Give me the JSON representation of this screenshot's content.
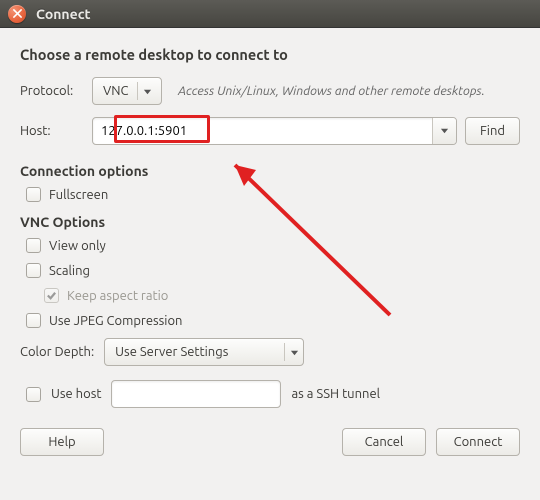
{
  "window": {
    "title": "Connect"
  },
  "heading": "Choose a remote desktop to connect to",
  "protocol": {
    "label": "Protocol:",
    "value": "VNC",
    "hint": "Access Unix/Linux, Windows and other remote desktops."
  },
  "host": {
    "label": "Host:",
    "value": "127.0.0.1:5901",
    "find_label": "Find"
  },
  "connection_options": {
    "heading": "Connection options",
    "fullscreen": {
      "label": "Fullscreen",
      "checked": false
    }
  },
  "vnc_options": {
    "heading": "VNC Options",
    "view_only": {
      "label": "View only",
      "checked": false
    },
    "scaling": {
      "label": "Scaling",
      "checked": false
    },
    "keep_aspect": {
      "label": "Keep aspect ratio",
      "checked": true,
      "disabled": true
    },
    "jpeg": {
      "label": "Use JPEG Compression",
      "checked": false
    },
    "color_depth": {
      "label": "Color Depth:",
      "value": "Use Server Settings"
    },
    "ssh": {
      "label": "Use host",
      "suffix": "as a SSH tunnel",
      "checked": false,
      "value": ""
    }
  },
  "buttons": {
    "help": "Help",
    "cancel": "Cancel",
    "connect": "Connect"
  }
}
